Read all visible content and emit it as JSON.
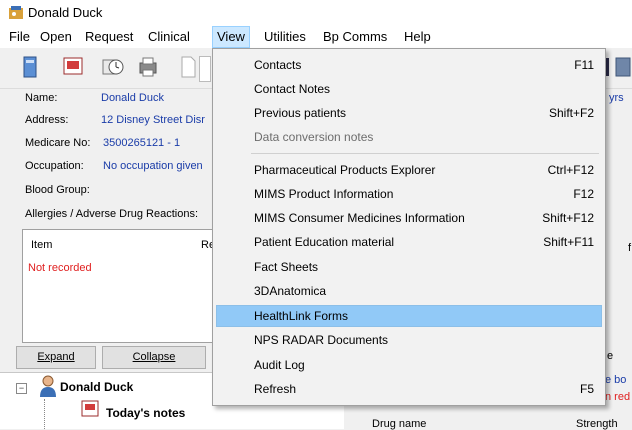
{
  "window": {
    "title": "Donald Duck"
  },
  "menubar": [
    "File",
    "Open",
    "Request",
    "Clinical",
    "View",
    "Utilities",
    "Bp Comms",
    "Help"
  ],
  "patient": {
    "name_label": "Name:",
    "name": "Donald Duck",
    "address_label": "Address:",
    "address": "12 Disney Street Disr",
    "medicare_label": "Medicare No:",
    "medicare": "3500265121 - 1",
    "occupation_label": "Occupation:",
    "occupation": "No occupation given",
    "blood_label": "Blood Group:",
    "allergies_label": "Allergies / Adverse Drug Reactions:",
    "age_fragment": "yrs"
  },
  "allergy_table": {
    "col_item": "Item",
    "col_re": "Re",
    "empty": "Not recorded"
  },
  "buttons": {
    "expand": "Expand",
    "collapse": "Collapse"
  },
  "tree": {
    "patient": "Donald Duck",
    "notes": "Today's notes"
  },
  "right_fragments": {
    "e": "e",
    "bo": "e bo",
    "red": "n red",
    "col_r": "f",
    "drug": "Drug name",
    "strength": "Strength"
  },
  "view_menu": [
    {
      "label": "Contacts",
      "shortcut": "F11"
    },
    {
      "label": "Contact Notes",
      "shortcut": ""
    },
    {
      "label": "Previous patients",
      "shortcut": "Shift+F2"
    },
    {
      "label": "Data conversion notes",
      "shortcut": "",
      "disabled": true
    },
    {
      "label": "Pharmaceutical Products Explorer",
      "shortcut": "Ctrl+F12"
    },
    {
      "label": "MIMS Product Information",
      "shortcut": "F12"
    },
    {
      "label": "MIMS Consumer Medicines Information",
      "shortcut": "Shift+F12"
    },
    {
      "label": "Patient Education material",
      "shortcut": "Shift+F11"
    },
    {
      "label": "Fact Sheets",
      "shortcut": ""
    },
    {
      "label": "3DAnatomica",
      "shortcut": ""
    },
    {
      "label": "HealthLink Forms",
      "shortcut": "",
      "highlighted": true
    },
    {
      "label": "NPS RADAR Documents",
      "shortcut": ""
    },
    {
      "label": "Audit Log",
      "shortcut": ""
    },
    {
      "label": "Refresh",
      "shortcut": "F5"
    }
  ]
}
